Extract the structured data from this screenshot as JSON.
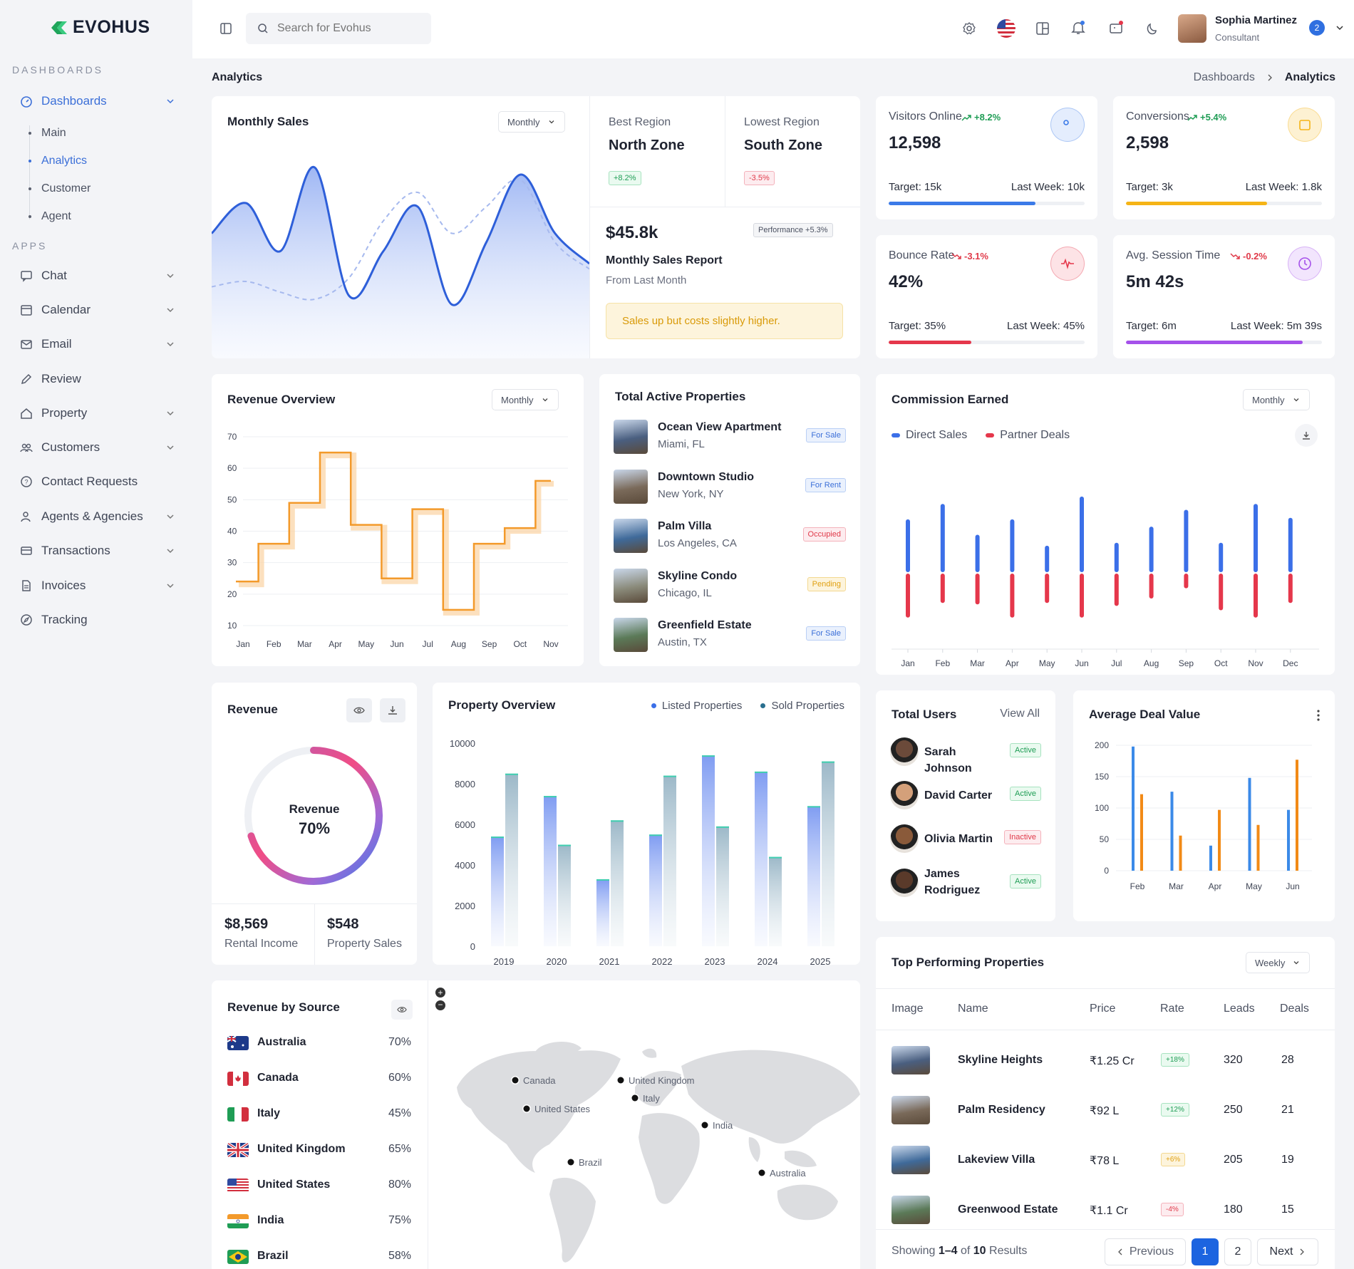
{
  "brand": {
    "name": "EVOHUS",
    "color": "#1fa55b"
  },
  "sidebar": {
    "section_dashboards": "DASHBOARDS",
    "section_apps": "APPS",
    "dashboards_label": "Dashboards",
    "sub": [
      "Main",
      "Analytics",
      "Customer",
      "Agent"
    ],
    "apps": [
      "Chat",
      "Calendar",
      "Email",
      "Review",
      "Property",
      "Customers",
      "Contact Requests",
      "Agents & Agencies",
      "Transactions",
      "Invoices",
      "Tracking"
    ]
  },
  "topbar": {
    "search_placeholder": "Search for Evohus",
    "user_name": "Sophia Martinez",
    "user_role": "Consultant",
    "notif_count": "2"
  },
  "page": {
    "title": "Analytics",
    "breadcrumb": [
      "Dashboards",
      "Analytics"
    ]
  },
  "monthly_sales": {
    "title": "Monthly Sales",
    "period": "Monthly",
    "best_label": "Best Region",
    "best_value": "North Zone",
    "best_change": "+8.2%",
    "lowest_label": "Lowest Region",
    "lowest_value": "South Zone",
    "lowest_change": "-3.5%",
    "amount": "$45.8k",
    "performance": "Performance +5.3%",
    "report_title": "Monthly Sales Report",
    "report_sub": "From Last Month",
    "note": "Sales up but costs slightly higher."
  },
  "stats": [
    {
      "label": "Visitors Online",
      "change": "+8.2%",
      "value": "12,598",
      "target": "Target: 15k",
      "last": "Last Week: 10k",
      "progress": 0.75,
      "color": "#3b7ae8",
      "icon": "users-icon"
    },
    {
      "label": "Conversions",
      "change": "+5.4%",
      "value": "2,598",
      "target": "Target: 3k",
      "last": "Last Week: 1.8k",
      "progress": 0.72,
      "color": "#f5b416",
      "icon": "bag-icon"
    },
    {
      "label": "Bounce Rate",
      "change": "-3.1%",
      "value": "42%",
      "target": "Target: 35%",
      "last": "Last Week: 45%",
      "progress": 0.42,
      "color": "#e5374b",
      "icon": "pulse-icon"
    },
    {
      "label": "Avg. Session Time",
      "change": "-0.2%",
      "value": "5m 42s",
      "target": "Target: 6m",
      "last": "Last Week: 5m 39s",
      "progress": 0.9,
      "color": "#a551ea",
      "icon": "clock-icon"
    }
  ],
  "revenue_overview": {
    "title": "Revenue Overview",
    "period": "Monthly"
  },
  "active_properties": {
    "title": "Total Active Properties",
    "items": [
      {
        "name": "Ocean View Apartment",
        "loc": "Miami, FL",
        "status": "For Sale"
      },
      {
        "name": "Downtown Studio",
        "loc": "New York, NY",
        "status": "For Rent"
      },
      {
        "name": "Palm Villa",
        "loc": "Los Angeles, CA",
        "status": "Occupied"
      },
      {
        "name": "Skyline Condo",
        "loc": "Chicago, IL",
        "status": "Pending"
      },
      {
        "name": "Greenfield Estate",
        "loc": "Austin, TX",
        "status": "For Sale"
      }
    ]
  },
  "commission": {
    "title": "Commission Earned",
    "period": "Monthly",
    "legend": [
      "Direct Sales",
      "Partner Deals"
    ]
  },
  "revenue_donut": {
    "title": "Revenue",
    "center_label": "Revenue",
    "center_value": "70%",
    "percent": 70,
    "rental_value": "$8,569",
    "rental_label": "Rental Income",
    "sales_value": "$548",
    "sales_label": "Property Sales"
  },
  "property_overview": {
    "title": "Property Overview",
    "legend": [
      "Listed Properties",
      "Sold Properties"
    ]
  },
  "total_users": {
    "title": "Total Users",
    "view_all": "View All",
    "users": [
      {
        "name": "Sarah Johnson",
        "status": "Active"
      },
      {
        "name": "David Carter",
        "status": "Active"
      },
      {
        "name": "Olivia Martin",
        "status": "Inactive"
      },
      {
        "name": "James Rodriguez",
        "status": "Active"
      }
    ]
  },
  "avg_deal": {
    "title": "Average Deal Value"
  },
  "revenue_source": {
    "title": "Revenue by Source",
    "rows": [
      {
        "country": "Australia",
        "pct": "70%"
      },
      {
        "country": "Canada",
        "pct": "60%"
      },
      {
        "country": "Italy",
        "pct": "45%"
      },
      {
        "country": "United Kingdom",
        "pct": "65%"
      },
      {
        "country": "United States",
        "pct": "80%"
      },
      {
        "country": "India",
        "pct": "75%"
      },
      {
        "country": "Brazil",
        "pct": "58%"
      }
    ],
    "map_labels": [
      "Canada",
      "United Kingdom",
      "United States",
      "Italy",
      "India",
      "Brazil",
      "Australia"
    ]
  },
  "top_properties": {
    "title": "Top Performing Properties",
    "period": "Weekly",
    "headers": [
      "Image",
      "Name",
      "Price",
      "Rate",
      "Leads",
      "Deals"
    ],
    "rows": [
      {
        "name": "Skyline Heights",
        "price": "₹1.25 Cr",
        "rate": "+18%",
        "leads": "320",
        "deals": "28"
      },
      {
        "name": "Palm Residency",
        "price": "₹92 L",
        "rate": "+12%",
        "leads": "250",
        "deals": "21"
      },
      {
        "name": "Lakeview Villa",
        "price": "₹78 L",
        "rate": "+6%",
        "leads": "205",
        "deals": "19"
      },
      {
        "name": "Greenwood Estate",
        "price": "₹1.1 Cr",
        "rate": "-4%",
        "leads": "180",
        "deals": "15"
      }
    ],
    "showing_prefix": "Showing",
    "showing_range": "1–4",
    "showing_of": "of",
    "showing_total": "10",
    "showing_suffix": "Results",
    "prev": "Previous",
    "next": "Next",
    "pages": [
      "1",
      "2"
    ]
  },
  "chart_data": [
    {
      "type": "area",
      "name": "monthly-sales",
      "series": [
        {
          "values": [
            0.55,
            0.72,
            0.45,
            0.92,
            0.2,
            0.45,
            0.7,
            0.15,
            0.5,
            0.88,
            0.55,
            0.38
          ]
        },
        {
          "values": [
            0.25,
            0.28,
            0.22,
            0.18,
            0.3,
            0.62,
            0.78,
            0.55,
            0.7,
            0.85,
            0.5,
            0.35
          ]
        }
      ]
    },
    {
      "type": "line",
      "name": "revenue-overview",
      "categories": [
        "Jan",
        "Feb",
        "Mar",
        "Apr",
        "May",
        "Jun",
        "Jul",
        "Aug",
        "Sep",
        "Oct",
        "Nov"
      ],
      "values": [
        24,
        36,
        49,
        65,
        42,
        25,
        47,
        15,
        36,
        41,
        56
      ],
      "ylim": [
        10,
        70
      ],
      "yticks": [
        10,
        20,
        30,
        40,
        50,
        60,
        70
      ]
    },
    {
      "type": "bar",
      "name": "commission-earned",
      "categories": [
        "Jan",
        "Feb",
        "Mar",
        "Apr",
        "May",
        "Jun",
        "Jul",
        "Aug",
        "Sep",
        "Oct",
        "Nov",
        "Dec"
      ],
      "series": [
        {
          "name": "Direct Sales",
          "values": [
            72,
            93,
            51,
            72,
            36,
            103,
            40,
            62,
            85,
            40,
            93,
            74
          ]
        },
        {
          "name": "Partner Deals",
          "values": [
            -60,
            -40,
            -42,
            -60,
            -40,
            -60,
            -44,
            -34,
            -20,
            -50,
            -60,
            -40
          ]
        }
      ]
    },
    {
      "type": "bar",
      "name": "property-overview",
      "categories": [
        "2019",
        "2020",
        "2021",
        "2022",
        "2023",
        "2024",
        "2025"
      ],
      "series": [
        {
          "name": "Listed Properties",
          "values": [
            5400,
            7400,
            3300,
            5500,
            9400,
            8600,
            6900
          ]
        },
        {
          "name": "Sold Properties",
          "values": [
            8500,
            5000,
            6200,
            8400,
            5900,
            4400,
            9100
          ]
        }
      ],
      "ylim": [
        0,
        10000
      ],
      "yticks": [
        0,
        2000,
        4000,
        6000,
        8000,
        10000
      ]
    },
    {
      "type": "bar",
      "name": "average-deal-value",
      "categories": [
        "Feb",
        "Mar",
        "Apr",
        "May",
        "Jun"
      ],
      "series": [
        {
          "values": [
            198,
            126,
            40,
            148,
            97
          ]
        },
        {
          "values": [
            122,
            56,
            97,
            73,
            177
          ]
        }
      ],
      "ylim": [
        0,
        200
      ],
      "yticks": [
        0,
        50,
        100,
        150,
        200
      ]
    }
  ]
}
